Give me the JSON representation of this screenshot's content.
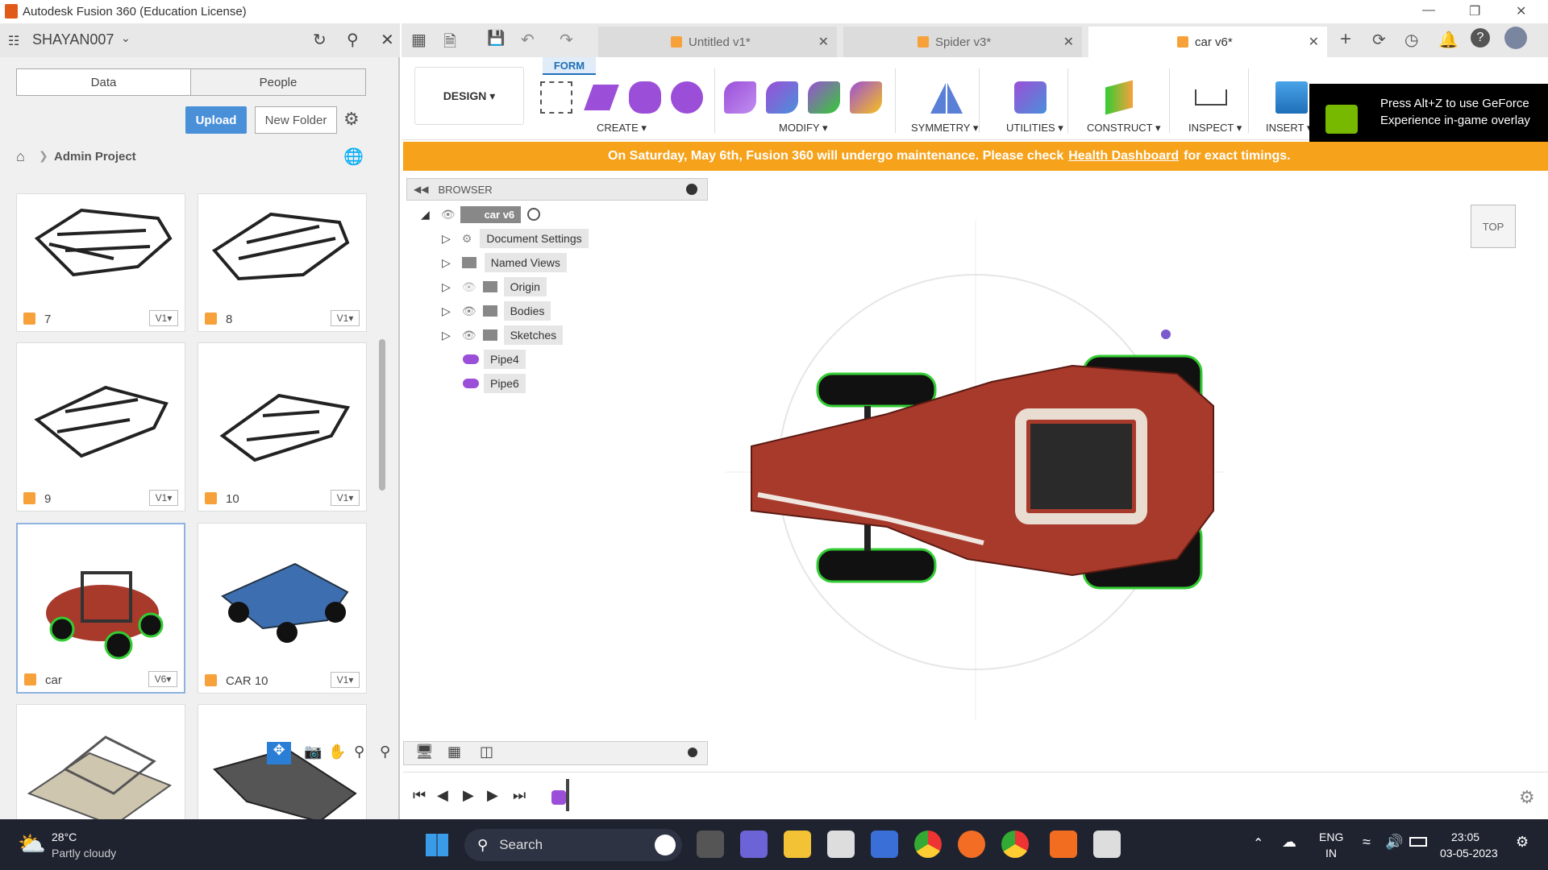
{
  "window": {
    "title": "Autodesk Fusion 360 (Education License)"
  },
  "datapanel": {
    "user": "SHAYAN007",
    "tabs": [
      "Data",
      "People"
    ],
    "upload_label": "Upload",
    "new_folder_label": "New Folder",
    "breadcrumb": "Admin Project",
    "items": [
      {
        "name": "7",
        "version": "V1"
      },
      {
        "name": "8",
        "version": "V1"
      },
      {
        "name": "9",
        "version": "V1"
      },
      {
        "name": "10",
        "version": "V1"
      },
      {
        "name": "car",
        "version": "V6"
      },
      {
        "name": "CAR 10",
        "version": "V1"
      }
    ]
  },
  "doctabs": [
    {
      "label": "Untitled v1*"
    },
    {
      "label": "Spider v3*"
    },
    {
      "label": "car v6*"
    }
  ],
  "toolbar": {
    "workspace": "DESIGN",
    "active_tab": "FORM",
    "groups": [
      "CREATE",
      "MODIFY",
      "SYMMETRY",
      "UTILITIES",
      "CONSTRUCT",
      "INSPECT",
      "INSERT"
    ]
  },
  "overlay": {
    "text": "Press Alt+Z to use GeForce Experience in-game overlay"
  },
  "banner": {
    "text": "On Saturday, May 6th, Fusion 360 will undergo maintenance. Please check",
    "link": "Health Dashboard",
    "tail": "for exact timings."
  },
  "browser": {
    "title": "BROWSER",
    "root": "car v6",
    "nodes": [
      "Document Settings",
      "Named Views",
      "Origin",
      "Bodies",
      "Sketches",
      "Pipe4",
      "Pipe6"
    ]
  },
  "viewcube": {
    "face": "TOP"
  },
  "taskbar": {
    "temp": "28°C",
    "weather": "Partly cloudy",
    "search": "Search",
    "lang1": "ENG",
    "lang2": "IN",
    "time": "23:05",
    "date": "03-05-2023"
  },
  "colors": {
    "accent": "#f7a21b",
    "upload": "#4a90d9",
    "car_body": "#a83a2c"
  }
}
